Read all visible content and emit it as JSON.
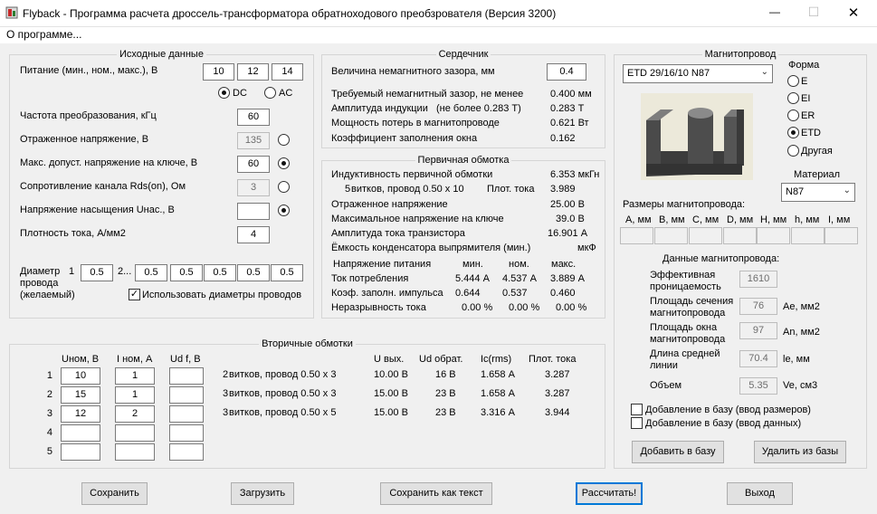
{
  "window": {
    "title": "Flyback - Программа расчета дроссель-трансформатора обратноходового преобзрователя (Версия 3200)",
    "minimize": "—",
    "maximize": "☐",
    "close": "✕"
  },
  "menu": {
    "about": "О программе..."
  },
  "input": {
    "title": "Исходные данные",
    "supply_label": "Питание (мин., ном., макс.), В",
    "supply_min": "10",
    "supply_nom": "12",
    "supply_max": "14",
    "dc": "DC",
    "ac": "AC",
    "freq_label": "Частота преобразования, кГц",
    "freq": "60",
    "refl_label": "Отраженное напряжение, В",
    "refl": "135",
    "vmax_label": "Макс. допуст. напряжение на ключе, В",
    "vmax": "60",
    "rds_label": "Сопротивление канала Rds(on), Ом",
    "rds": "3",
    "vsat_label": "Напряжение насыщения Uнас., В",
    "vsat": "",
    "jdens_label": "Плотность тока, А/мм2",
    "jdens": "4",
    "wire_label1": "Диаметр",
    "wire_label2": "провода",
    "wire_label3": "(желаемый)",
    "wire_n1": "1",
    "wire_n2": "2...",
    "wire_d1": "0.5",
    "wire_d2": [
      "0.5",
      "0.5",
      "0.5",
      "0.5",
      "0.5"
    ],
    "use_diam": "Использовать диаметры проводов"
  },
  "core": {
    "title": "Сердечник",
    "gap_label": "Величина немагнитного зазора, мм",
    "gap": "0.4",
    "rows": [
      {
        "label": "Требуемый немагнитный зазор, не менее",
        "value": "0.400 мм"
      },
      {
        "label": "Амплитуда индукции",
        "note": "(не более 0.283 Т)",
        "value": "0.283 Т"
      },
      {
        "label": "Мощность потерь в магнитопроводе",
        "value": "0.621 Вт"
      },
      {
        "label": "Коэффициент заполнения окна",
        "value": "0.162"
      }
    ]
  },
  "primary": {
    "title": "Первичная обмотка",
    "ind_label": "Индуктивность первичной обмотки",
    "ind": "6.353 мкГн",
    "turns": "5",
    "turns_text": "витков,  провод  0.50 x 10",
    "dens_label": "Плот. тока",
    "dens": "3.989",
    "refl_label": "Отраженное напряжение",
    "refl": "25.00 В",
    "vmax_label": "Максимальное напряжение на ключе",
    "vmax": "39.0 В",
    "iamp_label": "Амплитуда тока транзистора",
    "iamp": "16.901 А",
    "cap_label": "Ёмкость конденсатора выпрямителя (мин.)",
    "cap_unit": "мкФ",
    "hdr_label": "Напряжение питания",
    "hdr_min": "мин.",
    "hdr_nom": "ном.",
    "hdr_max": "макс.",
    "table": [
      {
        "label": "Ток потребления",
        "min": "5.444 А",
        "nom": "4.537 А",
        "max": "3.889 А"
      },
      {
        "label": "Коэф. заполн. импульса",
        "min": "0.644",
        "nom": "0.537",
        "max": "0.460"
      },
      {
        "label": "Неразрывность тока",
        "min": "0.00 %",
        "nom": "0.00 %",
        "max": "0.00 %"
      }
    ]
  },
  "secondary": {
    "title": "Вторичные обмотки",
    "h_unom": "Uном, В",
    "h_inom": "I ном, А",
    "h_udf": "Ud f, В",
    "h_uout": "U вых.",
    "h_udrev": "Ud обрат.",
    "h_ic": "Ic(rms)",
    "h_dens": "Плот. тока",
    "rows": [
      {
        "n": "1",
        "u": "10",
        "i": "1",
        "udf": "",
        "turns": "2",
        "wire": "витков,  провод  0.50 x 3",
        "uout": "10.00 В",
        "udrev": "16 В",
        "ic": "1.658 А",
        "dens": "3.287"
      },
      {
        "n": "2",
        "u": "15",
        "i": "1",
        "udf": "",
        "turns": "3",
        "wire": "витков,  провод  0.50 x 3",
        "uout": "15.00 В",
        "udrev": "23 В",
        "ic": "1.658 А",
        "dens": "3.287"
      },
      {
        "n": "3",
        "u": "12",
        "i": "2",
        "udf": "",
        "turns": "3",
        "wire": "витков,  провод  0.50 x 5",
        "uout": "15.00 В",
        "udrev": "23 В",
        "ic": "3.316 А",
        "dens": "3.944"
      },
      {
        "n": "4",
        "u": "",
        "i": "",
        "udf": ""
      },
      {
        "n": "5",
        "u": "",
        "i": "",
        "udf": ""
      }
    ]
  },
  "magcore": {
    "title": "Магнитопровод",
    "select": "ETD 29/16/10 N87",
    "shape_label": "Форма",
    "shapes": [
      "E",
      "EI",
      "ER",
      "ETD",
      "Другая"
    ],
    "material_label": "Материал",
    "material": "N87",
    "dims_label": "Размеры магнитопровода:",
    "dims": [
      "A, мм",
      "B, мм",
      "C, мм",
      "D, мм",
      "H, мм",
      "h, мм",
      "I, мм"
    ],
    "data_label": "Данные магнитопровода:",
    "perm_label1": "Эффективная",
    "perm_label2": "проницаемость",
    "perm": "1610",
    "ae_label1": "Площадь сечения",
    "ae_label2": "магнитопровода",
    "ae": "76",
    "ae_unit": "Ae, мм2",
    "an_label1": "Площадь окна",
    "an_label2": "магнитопровода",
    "an": "97",
    "an_unit": "An, мм2",
    "le_label1": "Длина средней",
    "le_label2": "линии",
    "le": "70.4",
    "le_unit": "le, мм",
    "ve_label": "Объем",
    "ve": "5.35",
    "ve_unit": "Ve, см3",
    "add_dims": "Добавление в базу (ввод размеров)",
    "add_data": "Добавление в базу (ввод данных)",
    "add_btn": "Добавить в базу",
    "del_btn": "Удалить из базы"
  },
  "buttons": {
    "save": "Сохранить",
    "load": "Загрузить",
    "save_text": "Сохранить как текст",
    "calc": "Рассчитать!",
    "exit": "Выход"
  }
}
